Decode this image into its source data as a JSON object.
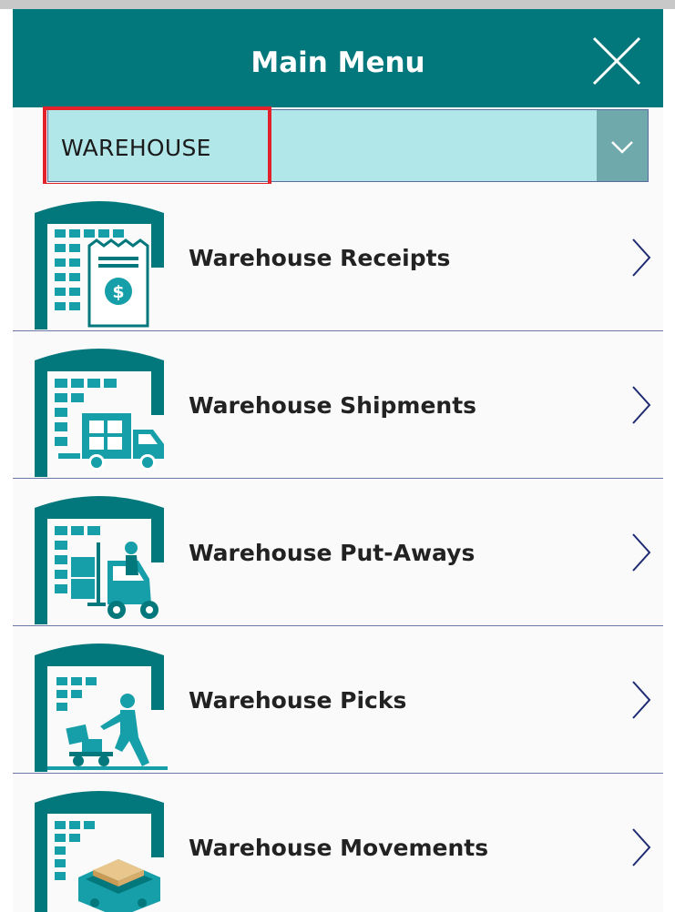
{
  "header": {
    "title": "Main Menu",
    "close_icon": "close-icon"
  },
  "dropdown": {
    "selected": "WAREHOUSE",
    "arrow_icon": "chevron-down-icon"
  },
  "menu_items": [
    {
      "label": "Warehouse Receipts",
      "icon": "warehouse-receipt-icon"
    },
    {
      "label": "Warehouse Shipments",
      "icon": "warehouse-truck-icon"
    },
    {
      "label": "Warehouse Put-Aways",
      "icon": "warehouse-forklift-icon"
    },
    {
      "label": "Warehouse Picks",
      "icon": "warehouse-handtruck-icon"
    },
    {
      "label": "Warehouse Movements",
      "icon": "warehouse-box-icon"
    }
  ],
  "colors": {
    "header_bg": "#03787c",
    "accent": "#169fa8",
    "dropdown_bg": "#b2e7ea",
    "highlight": "#e2222b",
    "chevron": "#1e2b72"
  }
}
